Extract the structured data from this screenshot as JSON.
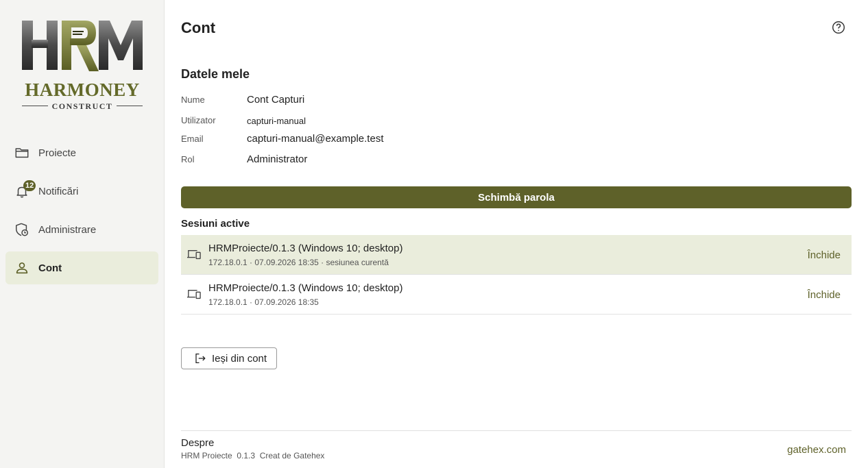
{
  "brand": {
    "logo_letters": "HRM",
    "name": "HARMONEY",
    "subtitle": "CONSTRUCT"
  },
  "sidebar": {
    "items": [
      {
        "label": "Proiecte",
        "icon": "folder-icon"
      },
      {
        "label": "Notificări",
        "icon": "bell-icon",
        "badge": "12"
      },
      {
        "label": "Administrare",
        "icon": "shield-clock-icon"
      },
      {
        "label": "Cont",
        "icon": "person-icon",
        "active": true
      }
    ]
  },
  "page": {
    "title": "Cont",
    "help_icon": "help-circle-icon"
  },
  "profile": {
    "section_title": "Datele mele",
    "fields": [
      {
        "label": "Nume",
        "value": "Cont Capturi"
      },
      {
        "label": "Utilizator",
        "value": "capturi-manual"
      },
      {
        "label": "Email",
        "value": "capturi-manual@example.test"
      },
      {
        "label": "Rol",
        "value": "Administrator"
      }
    ],
    "change_password_label": "Schimbă parola"
  },
  "sessions": {
    "title": "Sesiuni active",
    "items": [
      {
        "name": "HRMProiecte/0.1.3 (Windows 10; desktop)",
        "meta": "172.18.0.1 · 07.09.2026 18:35 · sesiunea curentă",
        "close_label": "Închide",
        "current": true
      },
      {
        "name": "HRMProiecte/0.1.3 (Windows 10; desktop)",
        "meta": "172.18.0.1 · 07.09.2026 18:35",
        "close_label": "Închide",
        "current": false
      }
    ]
  },
  "logout": {
    "label": "Ieși din cont",
    "icon": "logout-icon"
  },
  "about": {
    "title": "Despre",
    "meta": "HRM Proiecte  0.1.3  Creat de Gatehex",
    "link": "gatehex.com"
  },
  "colors": {
    "accent": "#5e6129",
    "active_bg": "#eaeddc",
    "sidebar_bg": "#f4f4f2",
    "brand_text": "#646a2a"
  }
}
